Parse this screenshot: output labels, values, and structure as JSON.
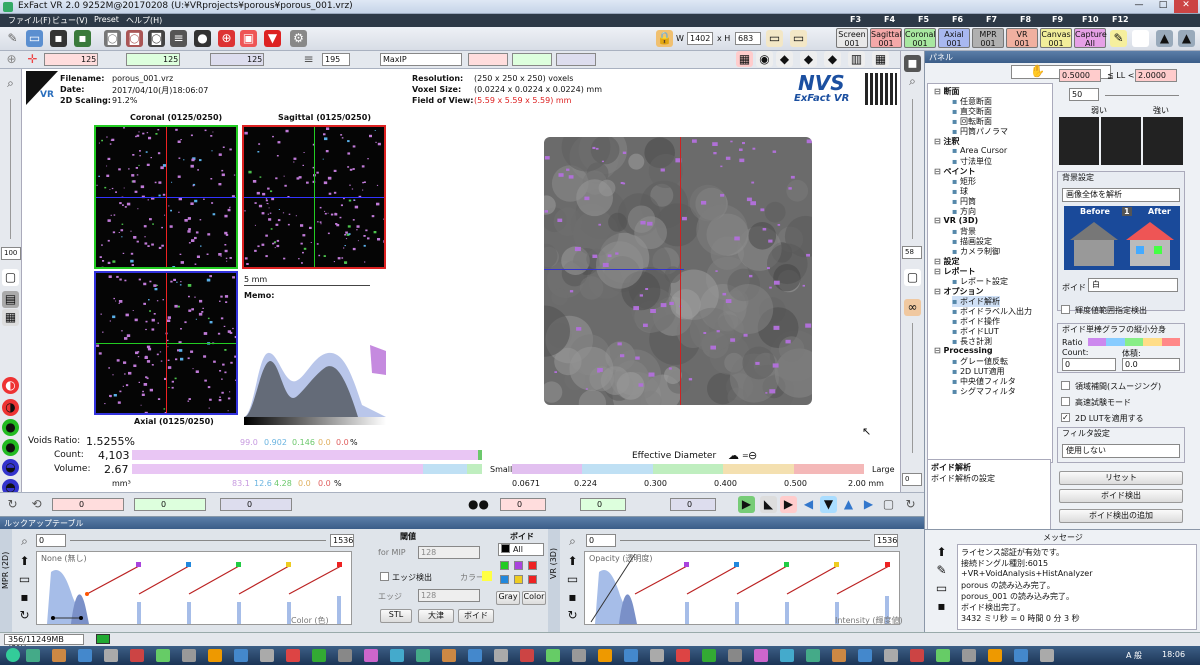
{
  "window": {
    "title": "ExFact VR 2.0 9252M@20170208 (U:¥VRprojects¥porous¥porous_001.vrz)",
    "controls": [
      "—",
      "□",
      "✕"
    ]
  },
  "menu": [
    "ファイル(F)",
    "ビュー(V)",
    "Preset",
    "ヘルプ(H)"
  ],
  "fkeys": [
    "F3",
    "F4",
    "F5",
    "F6",
    "F7",
    "F8",
    "F9",
    "F10",
    "F12"
  ],
  "toolbar": {
    "w_label": "W",
    "w_value": "1402",
    "h_label": "x H",
    "h_value": "683"
  },
  "modes": [
    {
      "label": "Screen\n001",
      "color": "#e8e8e8"
    },
    {
      "label": "Sagittal\n001",
      "color": "#f4a8a8"
    },
    {
      "label": "Coronal\n001",
      "color": "#a8e8a0"
    },
    {
      "label": "Axial\n001",
      "color": "#a8b8f0"
    },
    {
      "label": "MPR\n001",
      "color": "#b0b0b0"
    },
    {
      "label": "VR\n001",
      "color": "#f0b0a0"
    },
    {
      "label": "Canvas\n001",
      "color": "#f2ee9a"
    },
    {
      "label": "Capture\nAll",
      "color": "#e6a0e6"
    }
  ],
  "toolbar2": {
    "sag": "125",
    "cor": "125",
    "ax": "125",
    "thick": "195",
    "mode": "MaxIP"
  },
  "header": {
    "filename_label": "Filename:",
    "filename": "porous_001.vrz",
    "date_label": "Date:",
    "date": "2017/04/10(月)18:06:07",
    "scaling_label": "2D Scaling:",
    "scaling": "91.2%",
    "res_label": "Resolution:",
    "res": "(250 x 250 x 250) voxels",
    "voxel_label": "Voxel Size:",
    "voxel": "(0.0224 x 0.0224 x 0.0224) mm",
    "fov_label": "Field of View:",
    "fov": "(5.59 x 5.59 x 5.59) mm",
    "logo": "NVS",
    "logo_sub": "ExFact VR",
    "vr_badge": "VR"
  },
  "views": {
    "coronal": "Coronal (0125/0250)",
    "sagittal": "Sagittal (0125/0250)",
    "axial": "Axial (0125/0250)",
    "scale": "5 mm",
    "memo": "Memo:"
  },
  "left_zoom": "100",
  "right_zoom": "58",
  "right_zoom2": "0",
  "voids": {
    "title": "Voids",
    "ratio_label": "Ratio:",
    "ratio": "1.5255%",
    "count_label": "Count:",
    "count": "4,103",
    "volume_label": "Volume:",
    "volume": "2.67",
    "unit": "mm³",
    "ratio_parts": [
      "99.0",
      "0.902",
      "0.146",
      "0.0",
      "0.0",
      "%"
    ],
    "volume_parts": [
      "83.1",
      "12.6",
      "4.28",
      "0.0",
      "0.0",
      "%"
    ],
    "eff_label": "Effective Diameter",
    "eff_eq": "=",
    "small": "Small",
    "large": "Large",
    "ticks": [
      "0.0671",
      "0.224",
      "0.300",
      "0.400",
      "0.500",
      "2.00 mm"
    ]
  },
  "bottom_bar": {
    "v1": "0",
    "v2": "0",
    "v3": "0",
    "v4": "0",
    "v5": "0",
    "v6": "0"
  },
  "lut": {
    "title": "ルックアップテーブル",
    "mpr_tab": "MPR (2D)",
    "vr_tab": "VR (3D)",
    "left_lo": "0",
    "left_hi": "1536",
    "left_mode": "None (無し)",
    "left_axis": "Color (色)",
    "right_lo": "0",
    "right_hi": "1536",
    "right_mode": "Opacity (透明度)",
    "right_axis": "Intensity (輝度値)",
    "thresh_title": "閾値",
    "formip": "for MIP",
    "mip_val": "128",
    "edge_label": "エッジ検出",
    "edge_val": "128",
    "color_label": "カラー",
    "edge_short": "エッジ",
    "stl": "STL",
    "otsu": "大津",
    "void_btn": "ボイド",
    "void_title": "ボイド",
    "all": "All",
    "gray": "Gray",
    "color": "Color"
  },
  "panel": {
    "title": "パネル",
    "tree": [
      {
        "text": "断面",
        "lvl": 0,
        "bold": true
      },
      {
        "text": "任意断面",
        "lvl": 1
      },
      {
        "text": "直交断面",
        "lvl": 1
      },
      {
        "text": "回転断面",
        "lvl": 1
      },
      {
        "text": "円筒パノラマ",
        "lvl": 1
      },
      {
        "text": "注釈",
        "lvl": 0,
        "bold": true
      },
      {
        "text": "Area Cursor",
        "lvl": 1
      },
      {
        "text": "寸法単位",
        "lvl": 1
      },
      {
        "text": "ペイント",
        "lvl": 0,
        "bold": true
      },
      {
        "text": "矩形",
        "lvl": 1
      },
      {
        "text": "球",
        "lvl": 1
      },
      {
        "text": "円筒",
        "lvl": 1
      },
      {
        "text": "方向",
        "lvl": 1
      },
      {
        "text": "VR (3D)",
        "lvl": 0,
        "bold": true
      },
      {
        "text": "背景",
        "lvl": 1
      },
      {
        "text": "描画設定",
        "lvl": 1
      },
      {
        "text": "カメラ制御",
        "lvl": 1
      },
      {
        "text": "設定",
        "lvl": 0,
        "bold": true
      },
      {
        "text": "レポート",
        "lvl": 0,
        "bold": true
      },
      {
        "text": "レポート設定",
        "lvl": 1
      },
      {
        "text": "オプション",
        "lvl": 0,
        "bold": true
      },
      {
        "text": "ボイド解析",
        "lvl": 1
      },
      {
        "text": "ボイドラベル入出力",
        "lvl": 1
      },
      {
        "text": "ボイド操作",
        "lvl": 1
      },
      {
        "text": "ボイドLUT",
        "lvl": 1
      },
      {
        "text": "長さ計測",
        "lvl": 1
      },
      {
        "text": "Processing",
        "lvl": 0,
        "bold": true
      },
      {
        "text": "グレー値反転",
        "lvl": 1
      },
      {
        "text": "2D LUT適用",
        "lvl": 1
      },
      {
        "text": "中央値フィルタ",
        "lvl": 1
      },
      {
        "text": "シグマフィルタ",
        "lvl": 1
      }
    ],
    "desc_title": "ボイド解析",
    "desc": "ボイド解析の設定",
    "ll_lo": "0.5000",
    "ll_mid": "≦ LL <",
    "ll_hi": "2.0000",
    "ll_spin": "50",
    "weak": "弱い",
    "strong": "強い",
    "bg_title": "背景設定",
    "bg_sel": "画像全体を解析",
    "before": "Before",
    "after": "After",
    "bg_num": "1",
    "void_label": "ボイド",
    "void_val": "白",
    "cb1": "輝度値範囲指定検出",
    "graph_title": "ボイド単棒グラフの縦小分身",
    "ratio": "Ratio",
    "count": "Count:",
    "count_v": "0",
    "weight": "体積:",
    "weight_v": "0.0",
    "cb2": "領域補間(スムージング)",
    "cb3": "高速試験モード",
    "cb4": "2D LUTを適用する",
    "filter_title": "フィルタ設定",
    "filter_sel": "使用しない",
    "reset": "リセット",
    "detect": "ボイド検出",
    "add": "ボイド検出の追加"
  },
  "messages": {
    "title": "メッセージ",
    "lines": [
      "ライセンス認証が有効です。",
      "接続ドングル種別:6015",
      "+VR+VoidAnalysis+HistAnalyzer",
      "porous の読み込み完了。",
      "porous_001 の読み込み完了。",
      "ボイド検出完了。",
      "3432 ミリ秒 = 0 時間 0 分 3 秒"
    ]
  },
  "status": {
    "mem": "356/11249MB (3%)"
  },
  "taskbar": {
    "time": "18:06",
    "ime": "A 般"
  }
}
